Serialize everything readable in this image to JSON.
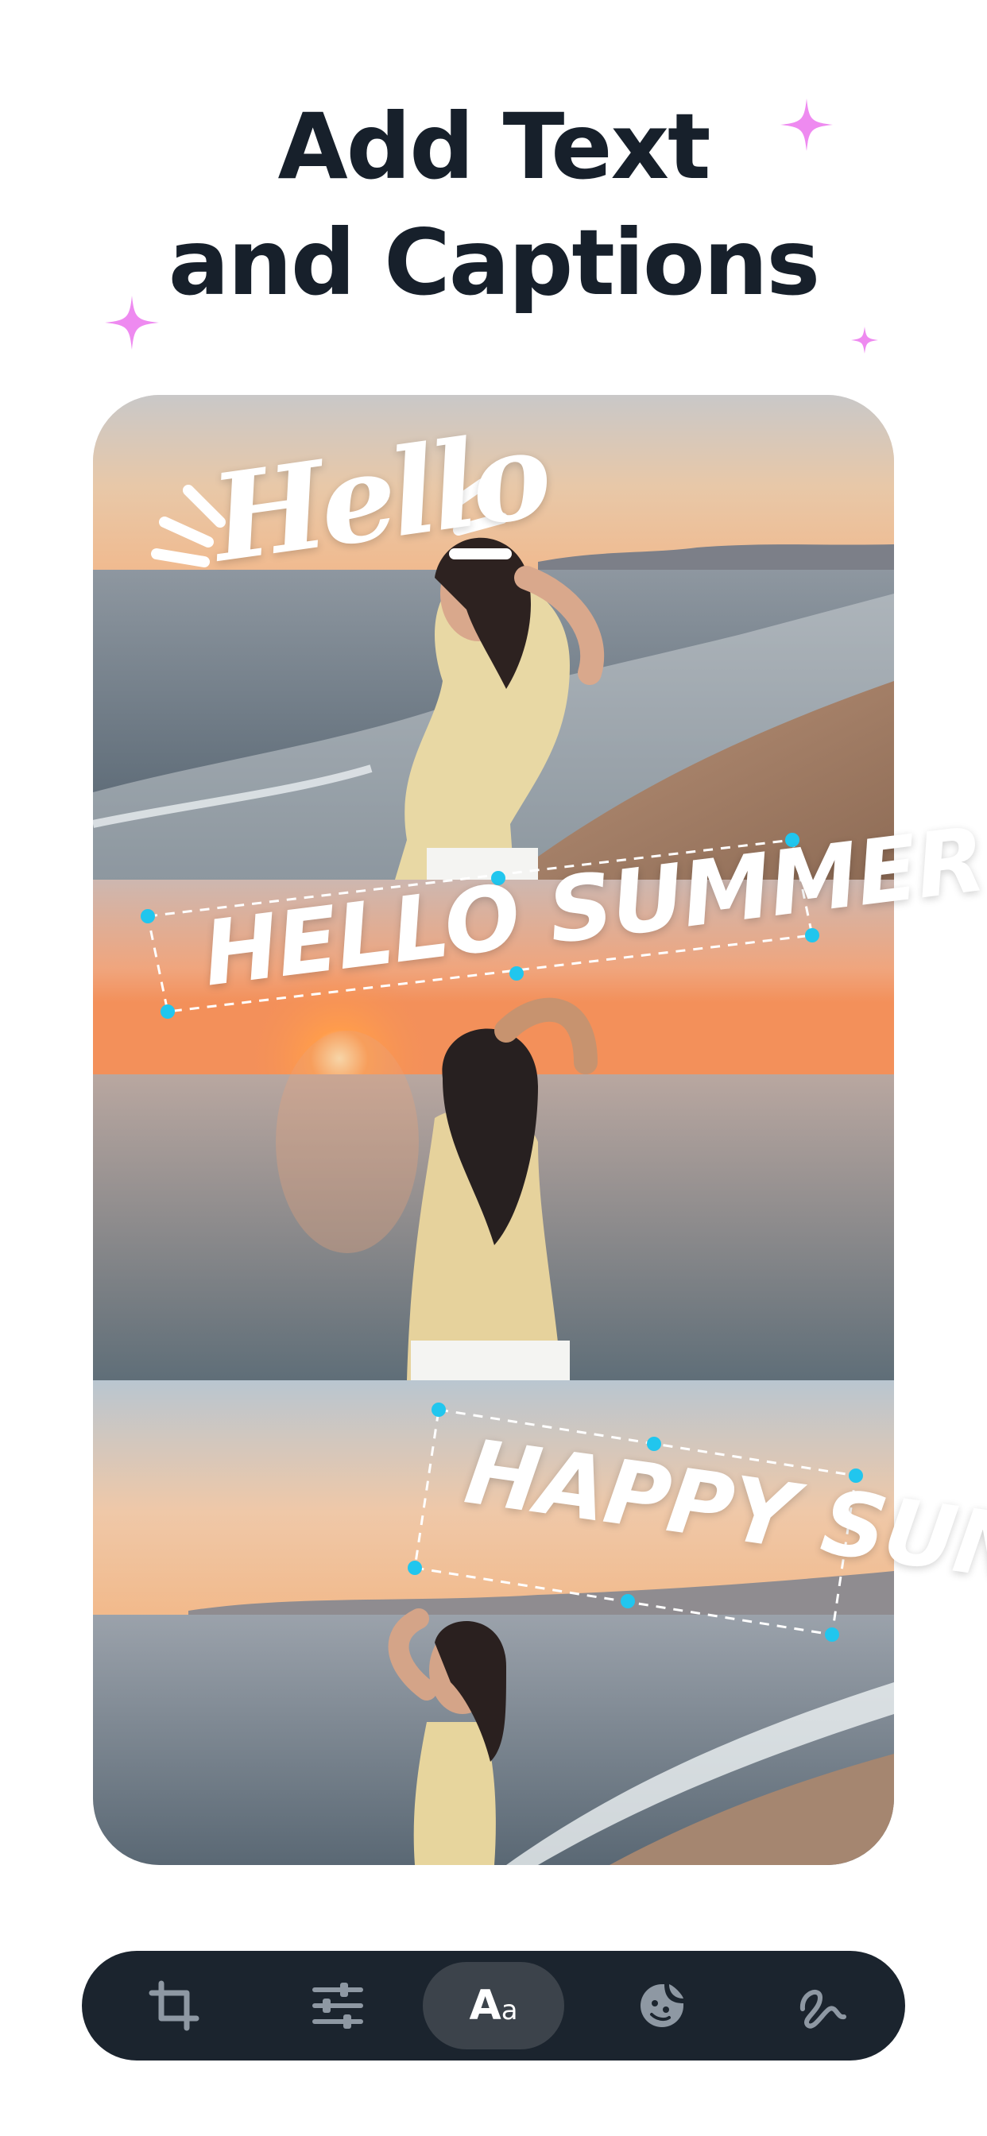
{
  "headline": {
    "line1": "Add Text",
    "line2": "and Captions"
  },
  "captions": {
    "hello": "Hello",
    "summer": "HELLO SUMMER",
    "sun": "HAPPY SUN"
  },
  "toolbar": {
    "items": [
      {
        "icon": "crop-icon",
        "active": false
      },
      {
        "icon": "adjust-sliders-icon",
        "active": false
      },
      {
        "icon": "text-icon",
        "label_big": "A",
        "label_small": "a",
        "active": true
      },
      {
        "icon": "sticker-icon",
        "active": false
      },
      {
        "icon": "draw-icon",
        "active": false
      }
    ]
  },
  "colors": {
    "headline": "#17202b",
    "sparkle": "#ee8af0",
    "handle": "#21c6ee",
    "toolbar_bg": "#1b242e",
    "toolbar_active": "#3c434b"
  }
}
